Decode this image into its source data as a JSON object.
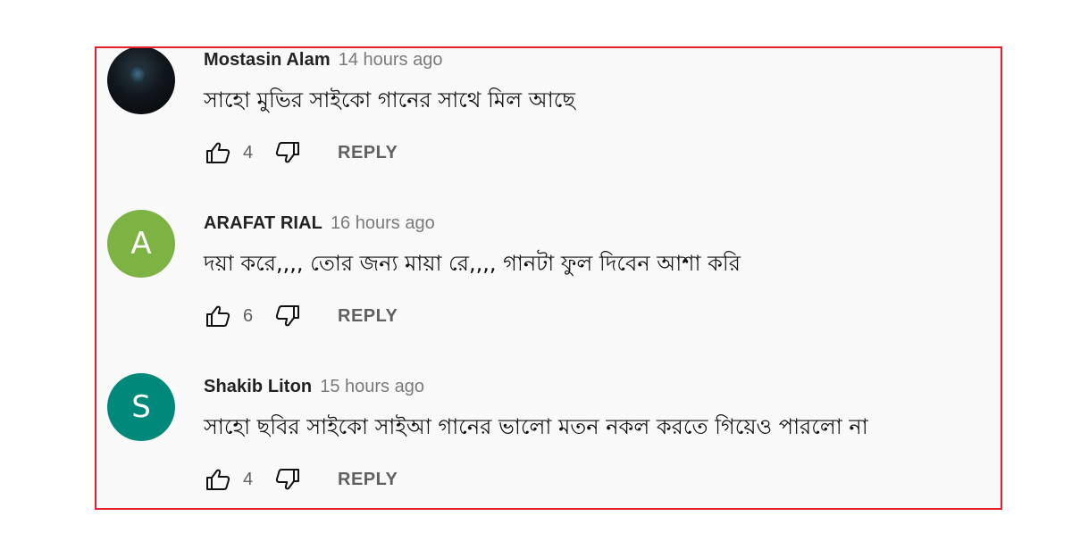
{
  "comments": [
    {
      "author": "Mostasin Alam",
      "time": "14 hours ago",
      "text": "সাহো মুভির সাইকো গানের সাথে মিল আছে",
      "likes": "4",
      "reply_label": "REPLY",
      "avatar": {
        "type": "photo",
        "letter": "",
        "color": "#0d1114"
      }
    },
    {
      "author": "ARAFAT RIAL",
      "time": "16 hours ago",
      "text": "দয়া করে,,,, তোর জন্য মায়া রে,,,, গানটা ফুল দিবেন আশা করি",
      "likes": "6",
      "reply_label": "REPLY",
      "avatar": {
        "type": "letter",
        "letter": "A",
        "color": "#7cb342"
      }
    },
    {
      "author": "Shakib Liton",
      "time": "15 hours ago",
      "text": "সাহো ছবির সাইকো সাইআ গানের ভালো মতন  নকল করতে গিয়েও পারলো না",
      "likes": "4",
      "reply_label": "REPLY",
      "avatar": {
        "type": "letter",
        "letter": "S",
        "color": "#00897b"
      }
    }
  ],
  "colors": {
    "frame_border": "#e5202a",
    "panel_background": "#f9f9f9",
    "secondary_text": "#606060"
  },
  "icons": {
    "like": "thumbs-up-icon",
    "dislike": "thumbs-down-icon"
  }
}
